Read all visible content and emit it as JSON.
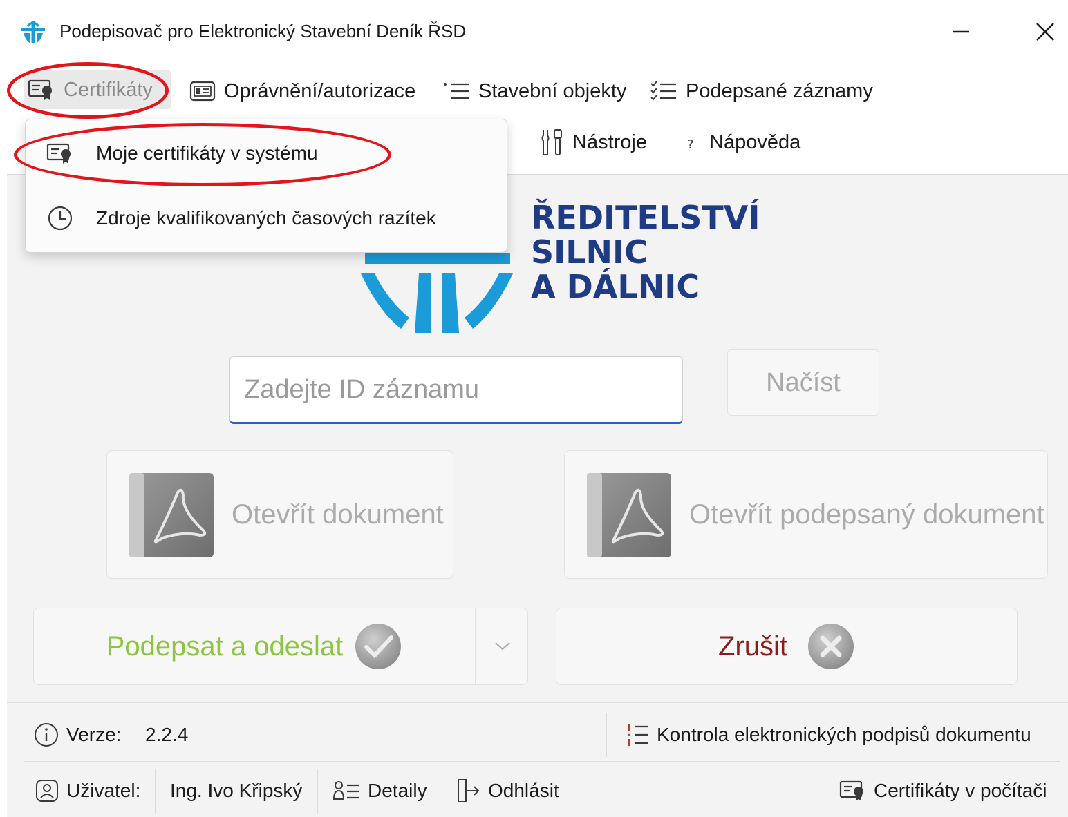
{
  "window": {
    "title": "Podepisovač pro Elektronický Stavební Deník ŘSD"
  },
  "menu": {
    "certifikaty": "Certifikáty",
    "opravneni": "Oprávnění/autorizace",
    "stavebni_objekty": "Stavební objekty",
    "podepsane_zaznamy": "Podepsané záznamy",
    "nastroje": "Nástroje",
    "napoveda": "Nápověda"
  },
  "dropdown": {
    "items": [
      {
        "label": "Moje certifikáty v systému",
        "icon": "certificate-icon"
      },
      {
        "label": "Zdroje kvalifikovaných časových razítek",
        "icon": "clock-icon"
      }
    ]
  },
  "logo": {
    "line1": "ŘEDITELSTVÍ",
    "line2": "SILNIC",
    "line3": "A DÁLNIC",
    "color": "#1e3b84",
    "mark_color": "#1b9bd7"
  },
  "record": {
    "placeholder": "Zadejte ID záznamu",
    "value": "",
    "load_label": "Načíst"
  },
  "documents": {
    "open_label": "Otevřít dokument",
    "open_signed_label": "Otevřít podepsaný dokument"
  },
  "actions": {
    "sign_label": "Podepsat a odeslat",
    "cancel_label": "Zrušit",
    "sign_color": "#8cc63e",
    "cancel_color": "#8b1c1c"
  },
  "status": {
    "version_label": "Verze:",
    "version_value": "2.2.4",
    "kontrola_label": "Kontrola elektronických podpisů dokumentu"
  },
  "user": {
    "label": "Uživatel:",
    "name": "Ing. Ivo Křipský",
    "details_label": "Detaily",
    "logout_label": "Odhlásit",
    "computer_certs_label": "Certifikáty v počítači"
  }
}
